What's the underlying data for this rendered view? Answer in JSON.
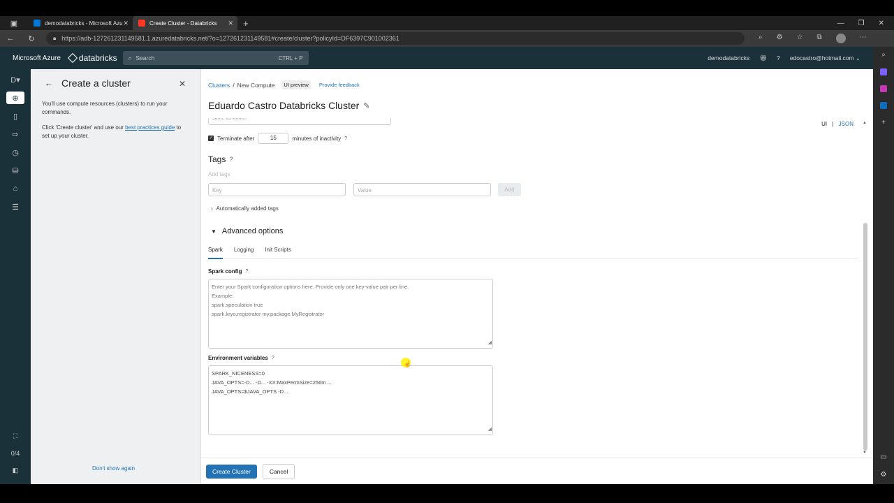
{
  "browser": {
    "tabs": [
      {
        "title": "demodatabricks - Microsoft Azu",
        "active": false
      },
      {
        "title": "Create Cluster - Databricks",
        "active": true
      }
    ],
    "url": "https://adb-127261231149581.1.azuredatabricks.net/?o=127261231149581#create/cluster?policyId=DF6397C901002361"
  },
  "header": {
    "ms_label": "Microsoft Azure",
    "brand": "databricks",
    "search_placeholder": "Search",
    "search_shortcut": "CTRL + P",
    "workspace": "demodatabricks",
    "user": "edocastro@hotmail.com"
  },
  "rail": {
    "counter": "0/4"
  },
  "guide": {
    "title": "Create a cluster",
    "p1": "You'll use compute resources (clusters) to run your commands.",
    "p2_prefix": "Click 'Create cluster' and use our ",
    "p2_link": "best practices guide",
    "p2_suffix": " to set up your cluster.",
    "dont_show": "Don't show again"
  },
  "page": {
    "breadcrumb_clusters": "Clusters",
    "breadcrumb_sep": "/",
    "breadcrumb_current": "New Compute",
    "ui_preview": "UI preview",
    "provide_feedback": "Provide feedback",
    "cluster_name": "Eduardo Castro Databricks Cluster",
    "toggle_ui": "UI",
    "toggle_sep": "|",
    "toggle_json": "JSON",
    "cut_field": "Same as worker",
    "terminate_label": "Terminate after",
    "terminate_value": "15",
    "terminate_suffix": "minutes of inactivity",
    "tags_title": "Tags",
    "add_tags": "Add tags",
    "key_placeholder": "Key",
    "value_placeholder": "Value",
    "add_button": "Add",
    "auto_tags": "Automatically added tags",
    "advanced_title": "Advanced options",
    "subtabs": [
      "Spark",
      "Logging",
      "Init Scripts"
    ],
    "spark_config_label": "Spark config",
    "spark_config_placeholder": [
      "Enter your Spark configuration options here. Provide only one key-value pair per line.",
      "Example:",
      "spark.speculation true",
      "spark.kryo.registrator my.package.MyRegistrator"
    ],
    "env_label": "Environment variables",
    "env_values": [
      "SPARK_NICENESS=0",
      "JAVA_OPTS=-D... -D... -XX:MaxPermSize=256m ...",
      "JAVA_OPTS=$JAVA_OPTS -D..."
    ],
    "create_button": "Create Cluster",
    "cancel_button": "Cancel"
  },
  "colors": {
    "accent": "#2272b4",
    "header_bg": "#1b3139"
  }
}
